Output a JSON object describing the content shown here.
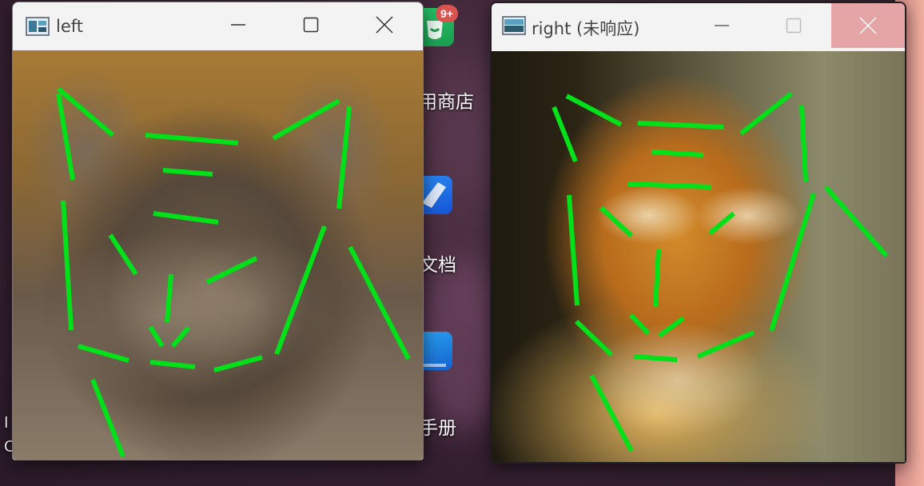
{
  "desktop": {
    "icons": [
      {
        "label": "用商店",
        "badge": "9+"
      },
      {
        "label": "文档"
      },
      {
        "label": "手册"
      }
    ],
    "left_edge_chars": [
      "I",
      "C"
    ]
  },
  "windows": {
    "left": {
      "title": "left"
    },
    "right": {
      "title": "right (未响应)"
    }
  },
  "colors": {
    "overlay_line": "#00e11a",
    "close_hover": "#e5a4a6",
    "badge": "#d9534f"
  },
  "icons": {
    "minimize": "minimize-icon",
    "maximize": "maximize-icon",
    "close": "close-icon",
    "app": "app-window-icon"
  }
}
